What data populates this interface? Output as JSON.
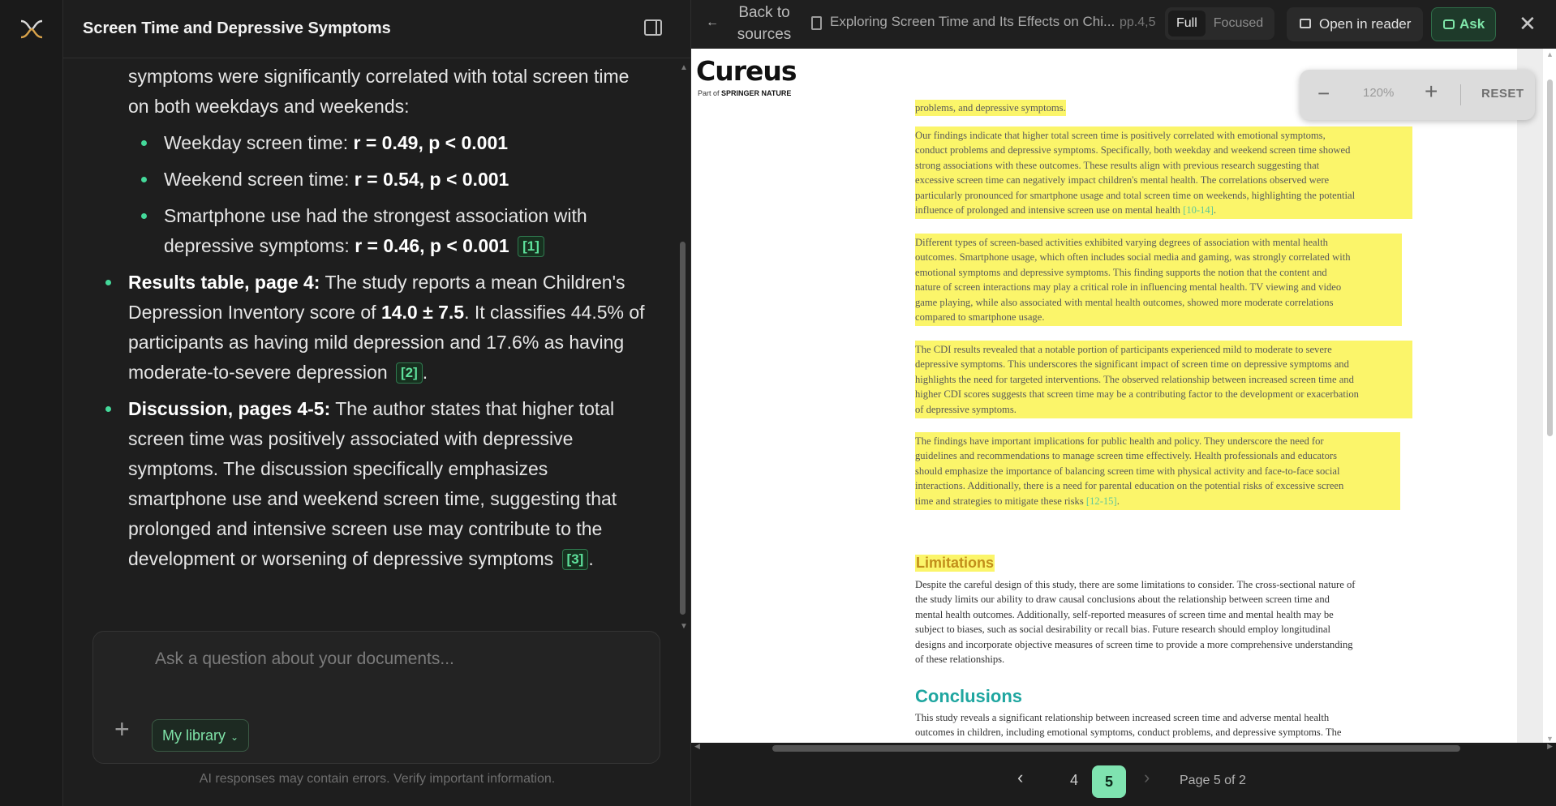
{
  "chat": {
    "title": "Screen Time and Depressive Symptoms",
    "intro": "symptoms were significantly correlated with total screen time on both weekdays and weekends:",
    "sub_items": [
      {
        "label": "Weekday screen time: ",
        "bold": "r = 0.49, p < 0.001",
        "cite": ""
      },
      {
        "label": "Weekend screen time: ",
        "bold": "r = 0.54, p < 0.001",
        "cite": ""
      },
      {
        "label": "Smartphone use had the strongest association with depressive symptoms: ",
        "bold": "r = 0.46, p < 0.001",
        "cite": "[1]"
      }
    ],
    "results": {
      "heading": "Results table, page 4:",
      "text1": " The study reports a mean Children's Depression Inventory score of ",
      "bold": "14.0 ± 7.5",
      "text2": ". It classifies 44.5% of participants as having mild depression and 17.6% as having moderate-to-severe depression",
      "cite": "[2]",
      "tail": "."
    },
    "discussion": {
      "heading": "Discussion, pages 4-5:",
      "text": " The author states that higher total screen time was positively associated with depressive symptoms. The discussion specifically emphasizes smartphone use and weekend screen time, suggesting that prolonged and intensive screen use may contribute to the development or worsening of depressive symptoms",
      "cite": "[3]",
      "tail": "."
    },
    "composer": {
      "placeholder": "Ask a question about your documents...",
      "plus": "+",
      "library_label": "My library",
      "chevron": "⌄"
    },
    "disclaimer": "AI responses may contain errors. Verify important information."
  },
  "reader": {
    "back_arrow": "←",
    "back_label": "Back to sources",
    "doc_title": "Exploring Screen Time and Its Effects on Chi...",
    "doc_pages": "pp.4,5",
    "view_modes": [
      "Full",
      "Focused"
    ],
    "active_mode": "Full",
    "open_reader": "Open in reader",
    "ask": "Ask",
    "close": "✕",
    "zoom": {
      "minus": "−",
      "level": "120%",
      "plus": "+",
      "reset": "RESET"
    },
    "pager": {
      "prev": "‹",
      "pages": [
        "4",
        "5"
      ],
      "current": "5",
      "next": "›",
      "status": "Page 5 of 2"
    }
  },
  "document": {
    "publisher": "Cureus",
    "publisher_sub_prefix": "Part of ",
    "publisher_sub_brand": "SPRINGER NATURE",
    "lead": "problems, and depressive symptoms.",
    "highlighted_paragraphs": [
      {
        "lines": [
          "Our findings indicate that higher total screen time is positively correlated with emotional symptoms,",
          "conduct problems and depressive symptoms. Specifically, both weekday and weekend screen time showed",
          "strong associations with these outcomes. These results align with previous research suggesting that",
          "excessive screen time can negatively impact children's mental health. The correlations observed were",
          "particularly pronounced for smartphone usage and total screen time on weekends, highlighting the potential",
          "influence of prolonged and intensive screen use on mental health "
        ],
        "ref": "[10-14]",
        "tail": "."
      },
      {
        "lines": [
          "Different types of screen-based activities exhibited varying degrees of association with mental health",
          "outcomes. Smartphone usage, which often includes social media and gaming, was strongly correlated with",
          "emotional symptoms and depressive symptoms. This finding supports the notion that the content and",
          "nature of screen interactions may play a critical role in influencing mental health. TV viewing and video",
          "game playing, while also associated with mental health outcomes, showed more moderate correlations",
          "compared to smartphone usage."
        ],
        "ref": "",
        "tail": ""
      },
      {
        "lines": [
          "The CDI results revealed that a notable portion of participants experienced mild to moderate to severe",
          "depressive symptoms. This underscores the significant impact of screen time on depressive symptoms and",
          "highlights the need for targeted interventions. The observed relationship between increased screen time and",
          "higher CDI scores suggests that screen time may be a contributing factor to the development or exacerbation",
          "of depressive symptoms."
        ],
        "ref": "",
        "tail": ""
      },
      {
        "lines": [
          "The findings have important implications for public health and policy. They underscore the need for",
          "guidelines and recommendations to manage screen time effectively. Health professionals and educators",
          "should emphasize the importance of balancing screen time with physical activity and face-to-face social",
          "interactions. Additionally, there is a need for parental education on the potential risks of excessive screen",
          "time and strategies to mitigate these risks "
        ],
        "ref": "[12-15]",
        "tail": "."
      }
    ],
    "limitations_heading": "Limitations",
    "limitations_lines": [
      "Despite the careful design of this study, there are some limitations to consider. The cross-sectional nature of",
      "the study limits our ability to draw causal conclusions about the relationship between screen time and",
      "mental health outcomes. Additionally, self-reported measures of screen time and mental health may be",
      "subject to biases, such as social desirability or recall bias. Future research should employ longitudinal",
      "designs and incorporate objective measures of screen time to provide a more comprehensive understanding",
      "of these relationships."
    ],
    "conclusions_heading": "Conclusions",
    "conclusions_lines": [
      "This study reveals a significant relationship between increased screen time and adverse mental health",
      "outcomes in children, including emotional symptoms, conduct problems, and depressive symptoms. The"
    ]
  }
}
